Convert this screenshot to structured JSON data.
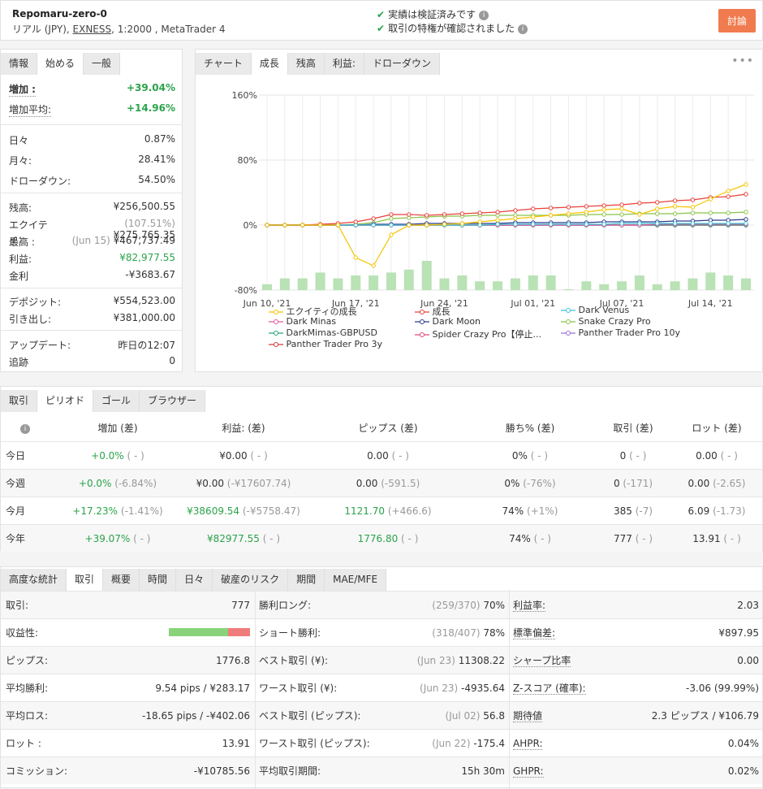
{
  "header": {
    "name": "Repomaru-zero-0",
    "desc_prefix": "リアル (JPY), ",
    "broker": "EXNESS",
    "desc_suffix": ", 1:2000 , MetaTrader 4",
    "verified": "実績は検証済みです",
    "privileges": "取引の特権が確認されました",
    "discuss": "討論"
  },
  "info": {
    "tabs": [
      "情報",
      "始める",
      "一般"
    ],
    "rows": [
      {
        "k": "増加 :",
        "v": "+39.04%"
      },
      {
        "k": "増加平均:",
        "v": "+14.96%"
      },
      {
        "k": "日々",
        "v": "0.87%"
      },
      {
        "k": "月々:",
        "v": "28.41%"
      },
      {
        "k": "ドローダウン:",
        "v": "54.50%"
      },
      {
        "k": "残高:",
        "v": "¥256,500.55"
      },
      {
        "k": "エクイティ:",
        "vp": "(107.51%)",
        "v": "¥275,765.35"
      },
      {
        "k": "最高 :",
        "vp": "(Jun 15)",
        "v": "¥467,737.49"
      },
      {
        "k": "利益:",
        "v": "¥82,977.55"
      },
      {
        "k": "金利",
        "v": "-¥3683.67"
      },
      {
        "k": "デポジット:",
        "v": "¥554,523.00"
      },
      {
        "k": "引き出し:",
        "v": "¥381,000.00"
      },
      {
        "k": "アップデート:",
        "v": "昨日の12:07"
      },
      {
        "k": "追跡",
        "v": "0"
      }
    ]
  },
  "chart_tabs": [
    "チャート",
    "成長",
    "残高",
    "利益:",
    "ドローダウン"
  ],
  "chart_more": "•••",
  "chart_data": {
    "type": "line",
    "ylim": [
      -80,
      160
    ],
    "yticks": [
      "160%",
      "80%",
      "0%",
      "-80%"
    ],
    "ytick_values": [
      160,
      80,
      0,
      -80
    ],
    "xticks": [
      "Jun 10, '21",
      "Jun 17, '21",
      "Jun 24, '21",
      "Jul 01, '21",
      "Jul 07, '21",
      "Jul 14, '21"
    ],
    "xtick_index": [
      0,
      5,
      10,
      15,
      20,
      25
    ],
    "bars": [
      2,
      4,
      4,
      6,
      4,
      5,
      5,
      6,
      7,
      10,
      4,
      5,
      3,
      3,
      4,
      5,
      5,
      0,
      3,
      2,
      3,
      5,
      2,
      3,
      4,
      6,
      5,
      4
    ],
    "series": [
      {
        "name": "エクイティの成長",
        "color": "#f5c400",
        "values": [
          0,
          0,
          0,
          0,
          0,
          -40,
          -50,
          -12,
          0,
          0,
          1,
          2,
          4,
          6,
          8,
          10,
          12,
          14,
          16,
          19,
          20,
          13,
          20,
          23,
          22,
          32,
          42,
          50
        ]
      },
      {
        "name": "成長",
        "color": "#e8403a",
        "values": [
          0,
          0,
          0,
          1,
          2,
          4,
          8,
          13,
          13,
          12,
          13,
          14,
          15,
          16,
          18,
          20,
          21,
          22,
          23,
          24,
          25,
          27,
          28,
          30,
          31,
          34,
          35,
          38
        ]
      },
      {
        "name": "Dark Venus",
        "color": "#3bc2d6",
        "values": [
          0,
          0,
          0,
          0,
          0,
          0,
          0,
          0,
          0,
          0,
          0,
          0,
          0,
          1,
          1,
          1,
          1,
          1,
          1,
          1,
          2,
          2,
          2,
          2,
          2,
          2,
          2,
          2
        ]
      },
      {
        "name": "Dark Minas",
        "color": "#e0589c",
        "values": [
          0,
          0,
          0,
          0,
          0,
          0,
          0,
          0,
          0,
          0,
          0,
          0,
          0,
          0,
          0,
          0,
          0,
          0,
          0,
          0,
          0,
          0,
          1,
          1,
          1,
          1,
          1,
          1
        ]
      },
      {
        "name": "Dark Moon",
        "color": "#2b3a8c",
        "values": [
          0,
          0,
          0,
          0,
          0,
          0,
          1,
          1,
          1,
          2,
          2,
          2,
          2,
          2,
          3,
          3,
          3,
          3,
          3,
          4,
          4,
          4,
          4,
          5,
          5,
          6,
          6,
          7
        ]
      },
      {
        "name": "Snake Crazy Pro",
        "color": "#8bc34a",
        "values": [
          0,
          0,
          0,
          0,
          0,
          1,
          3,
          8,
          9,
          10,
          11,
          11,
          12,
          12,
          12,
          12,
          12,
          12,
          13,
          13,
          13,
          14,
          14,
          14,
          15,
          15,
          15,
          16
        ]
      },
      {
        "name": "DarkMimas-GBPUSD",
        "color": "#2aa37a",
        "values": [
          0,
          0,
          0,
          0,
          0,
          0,
          0,
          0,
          0,
          0,
          0,
          0,
          0,
          0,
          0,
          0,
          0,
          0,
          0,
          0,
          0,
          0,
          0,
          0,
          0,
          0,
          0,
          0
        ]
      },
      {
        "name": "Spider Crazy Pro【停止...",
        "color": "#e0487a",
        "values": [
          0,
          0,
          0,
          0,
          0,
          0,
          0,
          0,
          0,
          0,
          0,
          0,
          0,
          0,
          0,
          0,
          0,
          0,
          0,
          0,
          0,
          0,
          0,
          0,
          0,
          0,
          0,
          0
        ]
      },
      {
        "name": "Panther Trader Pro 10y",
        "color": "#9b6fd6",
        "values": [
          0,
          0,
          0,
          0,
          0,
          0,
          0,
          0,
          0,
          0,
          0,
          0,
          0,
          0,
          0,
          0,
          0,
          0,
          0,
          0,
          0,
          0,
          0,
          0,
          0,
          0,
          0,
          0
        ]
      },
      {
        "name": "Panther Trader Pro 3y",
        "color": "#d23a3a",
        "values": [
          0,
          0,
          0,
          0,
          0,
          0,
          0,
          0,
          0,
          0,
          0,
          0,
          0,
          0,
          0,
          0,
          0,
          0,
          0,
          0,
          0,
          0,
          0,
          0,
          0,
          0,
          0,
          0
        ]
      }
    ]
  },
  "period": {
    "tabs": [
      "取引",
      "ピリオド",
      "ゴール",
      "ブラウザー"
    ],
    "headers": [
      "増加 (差)",
      "利益: (差)",
      "ピップス (差)",
      "勝ち% (差)",
      "取引 (差)",
      "ロット (差)"
    ],
    "rows": [
      {
        "label": "今日",
        "cells": [
          [
            "+0.0%",
            "( - )"
          ],
          [
            "¥0.00",
            "( - )"
          ],
          [
            "0.00",
            "( - )"
          ],
          [
            "0%",
            "( - )"
          ],
          [
            "0",
            "( - )"
          ],
          [
            "0.00",
            "( - )"
          ]
        ]
      },
      {
        "label": "今週",
        "cells": [
          [
            "+0.0%",
            "(-6.84%)"
          ],
          [
            "¥0.00",
            "(-¥17607.74)"
          ],
          [
            "0.00",
            "(-591.5)"
          ],
          [
            "0%",
            "(-76%)"
          ],
          [
            "0",
            "(-171)"
          ],
          [
            "0.00",
            "(-2.65)"
          ]
        ]
      },
      {
        "label": "今月",
        "cells": [
          [
            "+17.23%",
            "(-1.41%)"
          ],
          [
            "¥38609.54",
            "(-¥5758.47)"
          ],
          [
            "1121.70",
            "(+466.6)"
          ],
          [
            "74%",
            "(+1%)"
          ],
          [
            "385",
            "(-7)"
          ],
          [
            "6.09",
            "(-1.73)"
          ]
        ]
      },
      {
        "label": "今年",
        "cells": [
          [
            "+39.07%",
            "( - )"
          ],
          [
            "¥82977.55",
            "( - )"
          ],
          [
            "1776.80",
            "( - )"
          ],
          [
            "74%",
            "( - )"
          ],
          [
            "777",
            "( - )"
          ],
          [
            "13.91",
            "( - )"
          ]
        ]
      }
    ]
  },
  "stats": {
    "tabs": [
      "高度な統計",
      "取引",
      "概要",
      "時間",
      "日々",
      "破産のリスク",
      "期間",
      "MAE/MFE"
    ],
    "rows": [
      [
        {
          "k": "取引:",
          "v": "777"
        },
        {
          "k": "勝利ロング:",
          "vp": "(259/370)",
          "v": "70%"
        },
        {
          "k": "利益率:",
          "v": "2.03"
        }
      ],
      [
        {
          "k": "収益性:",
          "v": ""
        },
        {
          "k": "ショート勝利:",
          "vp": "(318/407)",
          "v": "78%"
        },
        {
          "k": "標準偏差:",
          "v": "¥897.95"
        }
      ],
      [
        {
          "k": "ピップス:",
          "v": "1776.8"
        },
        {
          "k": "ベスト取引 (¥):",
          "vp": "(Jun 23)",
          "v": "11308.22"
        },
        {
          "k": "シャープ比率",
          "v": "0.00"
        }
      ],
      [
        {
          "k": "平均勝利:",
          "v": "9.54 pips / ¥283.17"
        },
        {
          "k": "ワースト取引 (¥):",
          "vp": "(Jun 23)",
          "v": "-4935.64"
        },
        {
          "k": "Z-スコア (確率):",
          "v": "-3.06 (99.99%)"
        }
      ],
      [
        {
          "k": "平均ロス:",
          "v": "-18.65 pips / -¥402.06"
        },
        {
          "k": "ベスト取引 (ピップス):",
          "vp": "(Jul 02)",
          "v": "56.8"
        },
        {
          "k": "期待値",
          "v": "2.3 ピップス / ¥106.79"
        }
      ],
      [
        {
          "k": "ロット :",
          "v": "13.91"
        },
        {
          "k": "ワースト取引 (ピップス):",
          "vp": "(Jun 22)",
          "v": "-175.4"
        },
        {
          "k": "AHPR:",
          "v": "0.04%"
        }
      ],
      [
        {
          "k": "コミッション:",
          "v": "-¥10785.56"
        },
        {
          "k": "平均取引期間:",
          "v": "15h 30m"
        },
        {
          "k": "GHPR:",
          "v": "0.02%"
        }
      ]
    ],
    "profitability_win_fraction": 0.73
  }
}
